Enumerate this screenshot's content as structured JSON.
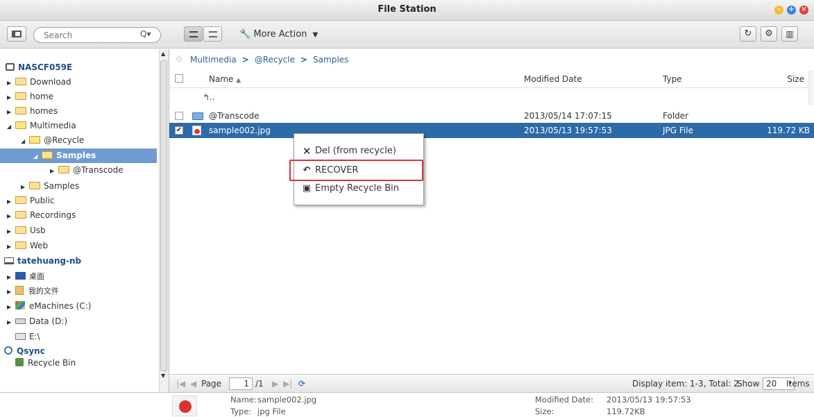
{
  "window": {
    "title": "File Station"
  },
  "toolbar": {
    "search_placeholder": "Search",
    "more_action_label": "More Action"
  },
  "sidebar": {
    "items": [
      {
        "label": "NASCF059E"
      },
      {
        "label": "Download"
      },
      {
        "label": "home"
      },
      {
        "label": "homes"
      },
      {
        "label": "Multimedia"
      },
      {
        "label": "@Recycle"
      },
      {
        "label": "Samples"
      },
      {
        "label": "@Transcode"
      },
      {
        "label": "Samples"
      },
      {
        "label": "Public"
      },
      {
        "label": "Recordings"
      },
      {
        "label": "Usb"
      },
      {
        "label": "Web"
      },
      {
        "label": "tatehuang-nb"
      },
      {
        "label": "桌面"
      },
      {
        "label": "我的文件"
      },
      {
        "label": "eMachines (C:)"
      },
      {
        "label": "Data (D:)"
      },
      {
        "label": "E:\\"
      },
      {
        "label": "Qsync"
      },
      {
        "label": "Recycle Bin"
      }
    ]
  },
  "breadcrumb": [
    "Multimedia",
    "@Recycle",
    "Samples"
  ],
  "table": {
    "columns": [
      "Name",
      "Modified Date",
      "Type",
      "Size"
    ],
    "up_label": "..",
    "rows": [
      {
        "name": "@Transcode",
        "modified": "2013/05/14 17:07:15",
        "type": "Folder",
        "size": ""
      },
      {
        "name": "sample002.jpg",
        "modified": "2013/05/13 19:57:53",
        "type": "JPG File",
        "size": "119.72 KB"
      }
    ]
  },
  "context_menu": {
    "items": [
      {
        "label": "Del (from recycle)",
        "icon": "x-icon"
      },
      {
        "label": "RECOVER",
        "icon": "recover-icon"
      },
      {
        "label": "Empty Recycle Bin",
        "icon": "recycle-bin-icon"
      }
    ]
  },
  "pager": {
    "page_label": "Page",
    "page_value": "1",
    "total_pages": "/1",
    "display_info": "Display item: 1-3, Total: 2",
    "show_label": "Show",
    "show_value": "20",
    "items_label": "Items"
  },
  "details": {
    "name_label": "Name:",
    "name_value": "sample002.jpg",
    "type_label": "Type:",
    "type_value": "jpg File",
    "modified_label": "Modified Date:",
    "modified_value": "2013/05/13 19:57:53",
    "size_label": "Size:",
    "size_value": "119.72KB"
  },
  "colors": {
    "selection": "#2d6aa8",
    "tree_selected": "#6f9bd0",
    "highlight_border": "#d0363c"
  }
}
